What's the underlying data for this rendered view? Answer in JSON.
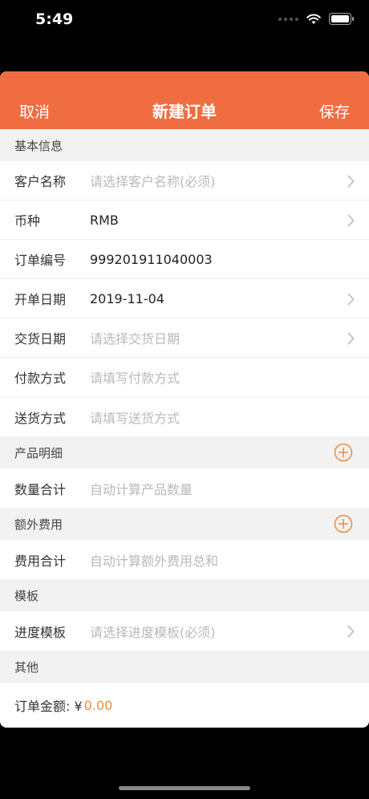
{
  "status": {
    "time": "5:49"
  },
  "nav": {
    "cancel": "取消",
    "title": "新建订单",
    "save": "保存"
  },
  "sections": {
    "basic": "基本信息",
    "products": "产品明细",
    "extra": "额外费用",
    "template": "模板",
    "other": "其他"
  },
  "basic_rows": [
    {
      "label": "客户名称",
      "value": "请选择客户名称(必须)",
      "placeholder": true,
      "chevron": true
    },
    {
      "label": "币种",
      "value": "RMB",
      "placeholder": false,
      "chevron": true
    },
    {
      "label": "订单编号",
      "value": "999201911040003",
      "placeholder": false,
      "chevron": false
    },
    {
      "label": "开单日期",
      "value": "2019-11-04",
      "placeholder": false,
      "chevron": true
    },
    {
      "label": "交货日期",
      "value": "请选择交货日期",
      "placeholder": true,
      "chevron": true
    },
    {
      "label": "付款方式",
      "value": "请填写付款方式",
      "placeholder": true,
      "chevron": false
    },
    {
      "label": "送货方式",
      "value": "请填写送货方式",
      "placeholder": true,
      "chevron": false
    }
  ],
  "products_row": {
    "label": "数量合计",
    "value": "自动计算产品数量"
  },
  "extra_row": {
    "label": "费用合计",
    "value": "自动计算额外费用总和"
  },
  "template_row": {
    "label": "进度模板",
    "value": "请选择进度模板(必须)"
  },
  "total": {
    "label": "订单金额: ¥",
    "value": "0.00"
  },
  "colors": {
    "accent": "#ef6d41",
    "amount": "#ef8a3a",
    "placeholder": "#b9b9b9"
  }
}
